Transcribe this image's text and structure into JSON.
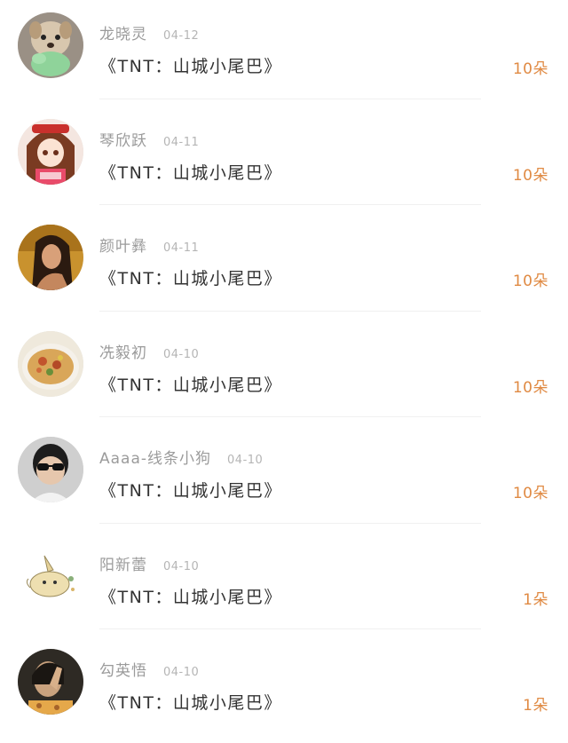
{
  "gifts": [
    {
      "user": "龙晓灵",
      "date": "04-12",
      "item": "《TNT：山城小尾巴》",
      "amount": "10朵",
      "avatar_icon": "plush-dog-avatar"
    },
    {
      "user": "琴欣跃",
      "date": "04-11",
      "item": "《TNT：山城小尾巴》",
      "amount": "10朵",
      "avatar_icon": "anime-girl-avatar"
    },
    {
      "user": "颜叶彝",
      "date": "04-11",
      "item": "《TNT：山城小尾巴》",
      "amount": "10朵",
      "avatar_icon": "woman-portrait-avatar"
    },
    {
      "user": "冼毅初",
      "date": "04-10",
      "item": "《TNT：山城小尾巴》",
      "amount": "10朵",
      "avatar_icon": "noodles-avatar"
    },
    {
      "user": "Aaaa-线条小狗",
      "date": "04-10",
      "item": "《TNT：山城小尾巴》",
      "amount": "10朵",
      "avatar_icon": "sunglasses-person-avatar"
    },
    {
      "user": "阳新蕾",
      "date": "04-10",
      "item": "《TNT：山城小尾巴》",
      "amount": "1朵",
      "avatar_icon": "cartoon-creature-avatar"
    },
    {
      "user": "勾英悟",
      "date": "04-10",
      "item": "《TNT：山城小尾巴》",
      "amount": "1朵",
      "avatar_icon": "hand-portrait-avatar"
    }
  ],
  "colors": {
    "amount": "#e08a43",
    "name": "#9b9b9b",
    "title": "#333333"
  }
}
